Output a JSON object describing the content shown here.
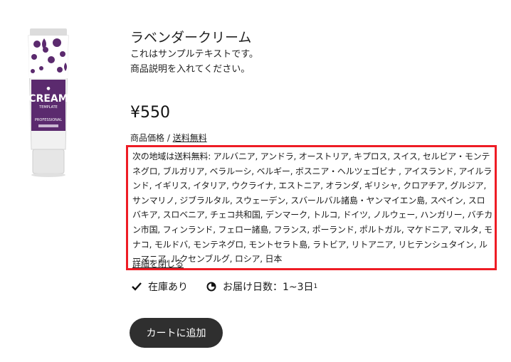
{
  "product": {
    "image_label": "CREAM",
    "image_sublabel": "TEMPLATE",
    "image_line": "PROFESSIONAL",
    "title": "ラベンダークリーム",
    "description_line1": "これはサンプルテキストです。",
    "description_line2": "商品説明を入れてください。",
    "price": "¥550",
    "price_label": "商品価格 / ",
    "shipping_link": "送料無料"
  },
  "shipping": {
    "text": "次の地域は送料無料: アルバニア, アンドラ, オーストリア, キプロス, スイス, セルビア・モンテネグロ, ブルガリア, ベラルーシ, ベルギー, ボスニア・ヘルツェゴビナ , アイスランド, アイルランド, イギリス, イタリア, ウクライナ, エストニア, オランダ, ギリシャ, クロアチア, グルジア, サンマリノ, ジブラルタル, スウェーデン, スバールバル諸島・ヤンマイエン島, スペイン, スロバキア, スロベニア, チェコ共和国, デンマーク, トルコ, ドイツ, ノルウェー, ハンガリー, バチカン市国, フィンランド, フェロー諸島, フランス, ポーランド, ポルトガル, マケドニア, マルタ, モナコ, モルドバ, モンテネグロ, モントセラト島, ラトビア, リトアニア, リヒテンシュタイン, ルーマニア, ルクセンブルグ, ロシア, 日本",
    "close_link": "詳細を閉じる"
  },
  "status": {
    "stock": "在庫あり",
    "delivery": "お届け日数：1~3日",
    "delivery_note": "1"
  },
  "actions": {
    "add_to_cart": "カートに追加"
  },
  "colors": {
    "highlight_border": "#ee1c25",
    "button_bg": "#2f2f2f",
    "image_purple": "#5b2a6e"
  },
  "icons": {
    "stock": "checkmark-icon",
    "delivery": "clock-icon"
  }
}
